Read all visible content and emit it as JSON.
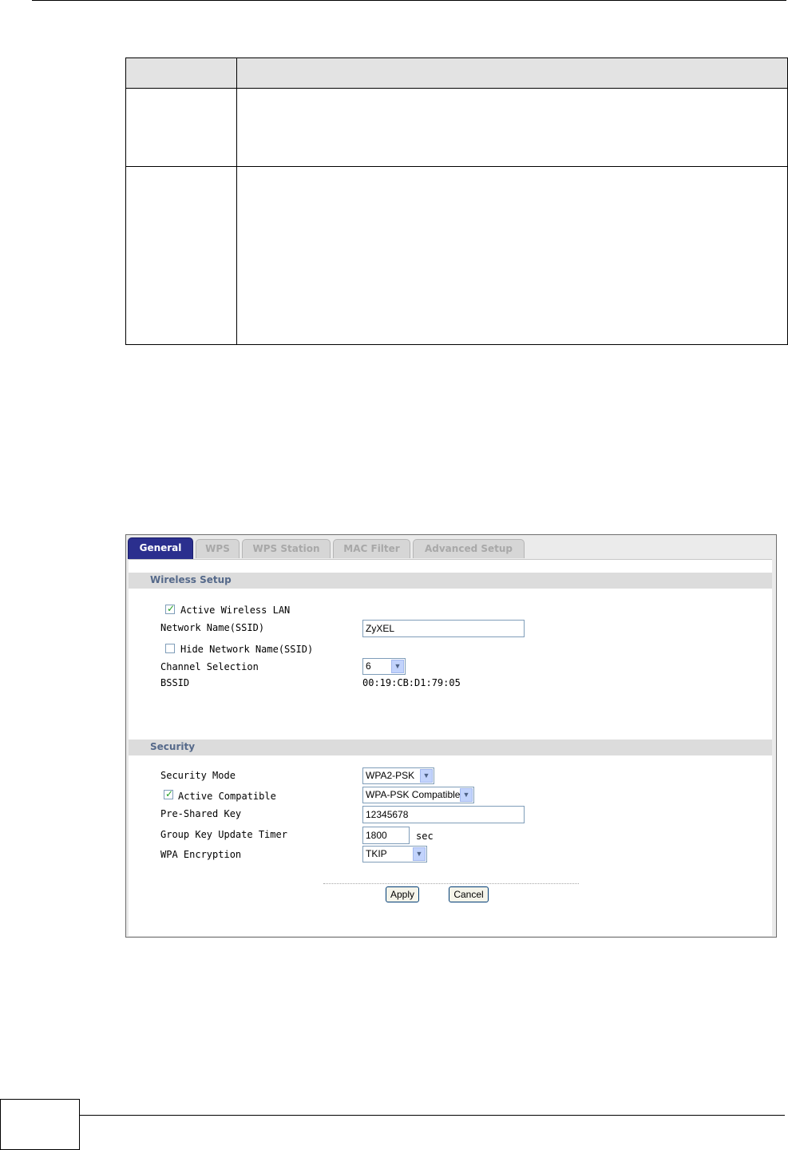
{
  "tabs": [
    {
      "label": "General",
      "active": true
    },
    {
      "label": "WPS",
      "active": false
    },
    {
      "label": "WPS Station",
      "active": false
    },
    {
      "label": "MAC Filter",
      "active": false
    },
    {
      "label": "Advanced Setup",
      "active": false
    }
  ],
  "wireless_setup": {
    "title": "Wireless Setup",
    "active_wlan": {
      "label": "Active Wireless LAN",
      "checked": true
    },
    "ssid": {
      "label": "Network Name(SSID)",
      "value": "ZyXEL"
    },
    "hide_ssid": {
      "label": "Hide Network Name(SSID)",
      "checked": false
    },
    "channel": {
      "label": "Channel Selection",
      "value": "6"
    },
    "bssid": {
      "label": "BSSID",
      "value": "00:19:CB:D1:79:05"
    }
  },
  "security": {
    "title": "Security",
    "mode": {
      "label": "Security Mode",
      "value": "WPA2-PSK"
    },
    "active_compatible": {
      "label": "Active Compatible",
      "checked": true,
      "value": "WPA-PSK Compatible"
    },
    "psk": {
      "label": "Pre-Shared Key",
      "value": "12345678"
    },
    "group_key_timer": {
      "label": "Group Key Update Timer",
      "value": "1800",
      "unit": "sec"
    },
    "encryption": {
      "label": "WPA Encryption",
      "value": "TKIP"
    }
  },
  "buttons": {
    "apply": "Apply",
    "cancel": "Cancel"
  },
  "icons": {
    "checkbox_mark": "check-icon",
    "dropdown": "chevron-down-icon"
  },
  "colors": {
    "active_tab": "#2b2f8e",
    "section_title": "#55698a",
    "section_bar": "#dcdcdc"
  }
}
